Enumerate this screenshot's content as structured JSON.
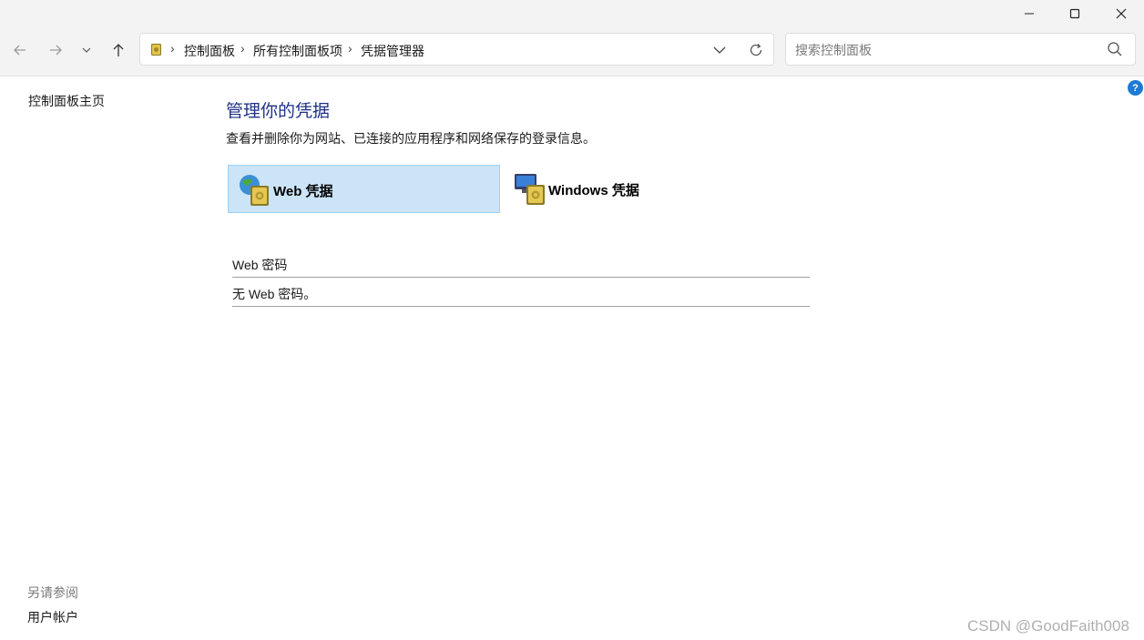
{
  "window": {
    "minimize_icon": "minimize-icon",
    "maximize_icon": "maximize-icon",
    "close_icon": "close-icon"
  },
  "nav": {
    "back_icon": "arrow-left-icon",
    "forward_icon": "arrow-right-icon",
    "recent_icon": "chevron-down-icon",
    "up_icon": "arrow-up-icon"
  },
  "address": {
    "breadcrumbs": [
      "控制面板",
      "所有控制面板项",
      "凭据管理器"
    ],
    "separator": "›",
    "dropdown_icon": "chevron-down-icon",
    "refresh_icon": "refresh-icon"
  },
  "search": {
    "placeholder": "搜索控制面板",
    "value": "",
    "icon": "search-icon"
  },
  "sidebar": {
    "home_link": "控制面板主页",
    "see_also_heading": "另请参阅",
    "see_also_links": [
      "用户帐户"
    ]
  },
  "main": {
    "title": "管理你的凭据",
    "description": "查看并删除你为网站、已连接的应用程序和网络保存的登录信息。",
    "tabs": [
      {
        "label": "Web 凭据",
        "icon": "globe-vault-icon",
        "selected": true
      },
      {
        "label": "Windows 凭据",
        "icon": "computer-vault-icon",
        "selected": false
      }
    ],
    "section_header": "Web 密码",
    "empty_message": "无 Web 密码。"
  },
  "help": {
    "label": "?"
  },
  "watermark": "CSDN @GoodFaith008",
  "colors": {
    "title_blue": "#1e3287",
    "selected_tile_bg": "#cce4f7",
    "selected_tile_border": "#99d1ff",
    "chrome_bg": "#f3f3f3",
    "help_blue": "#1e7ad2"
  }
}
